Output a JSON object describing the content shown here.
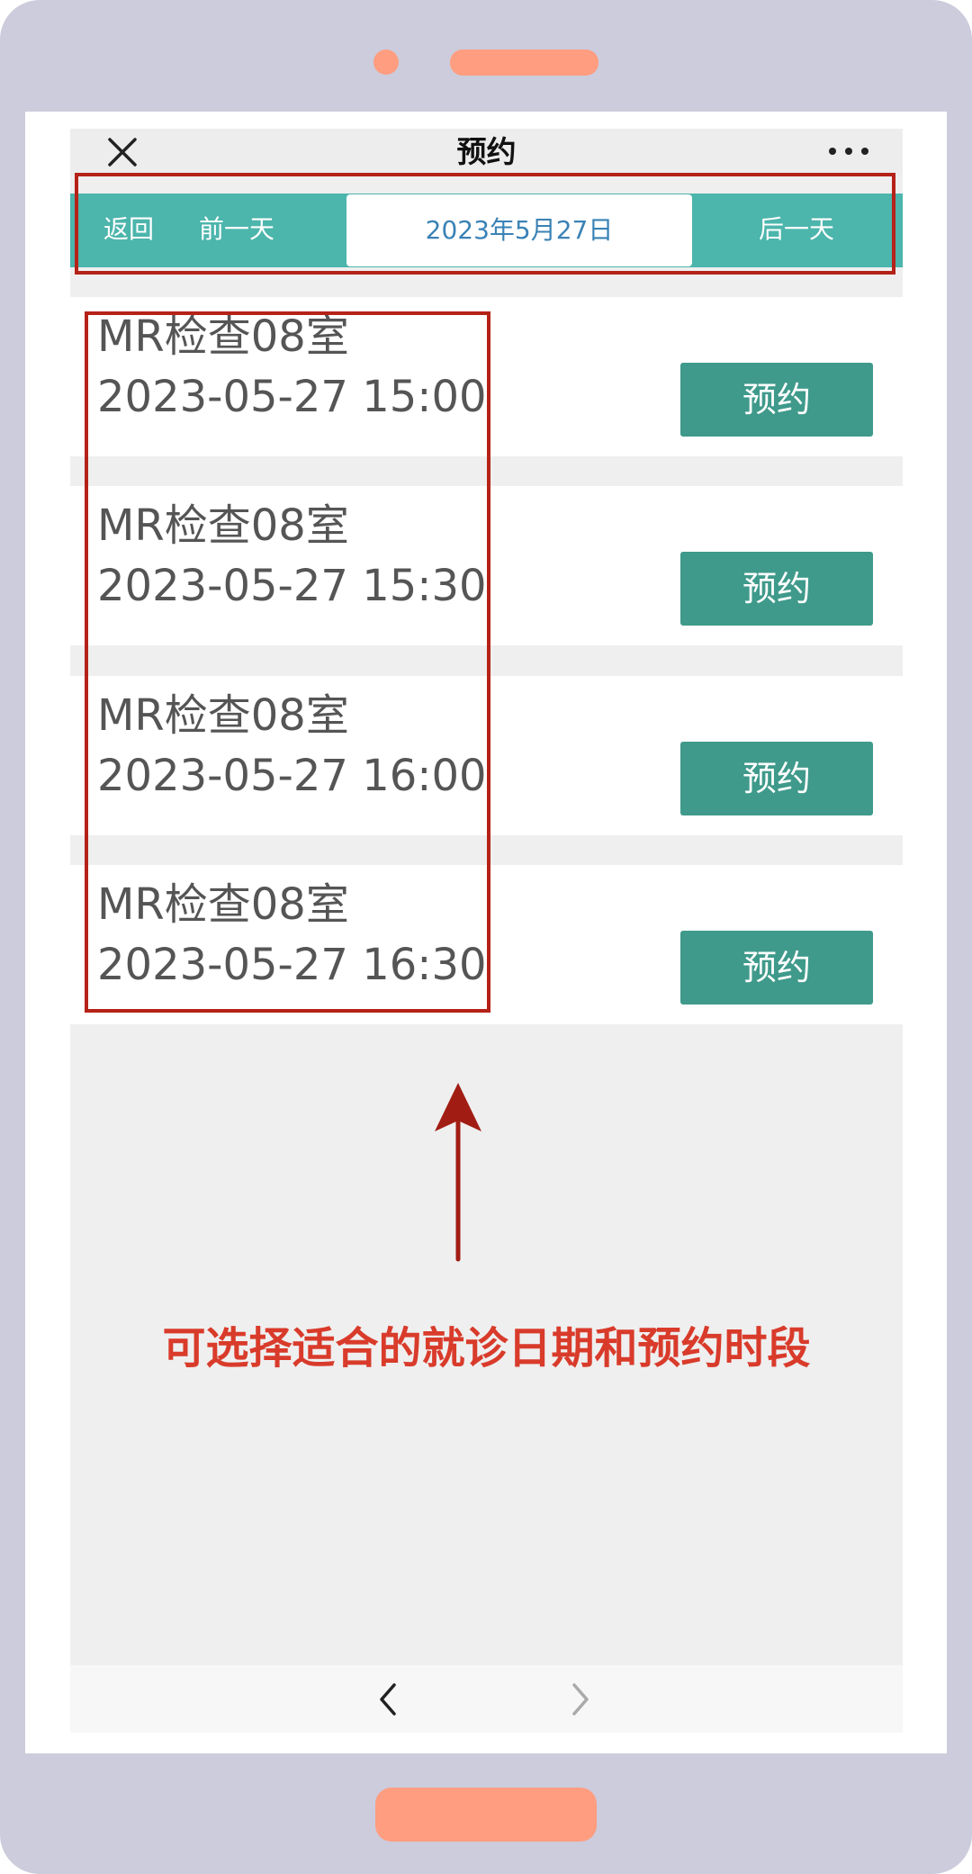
{
  "header": {
    "title": "预约",
    "close_icon": "close-icon",
    "more_icon": "more-icon"
  },
  "datebar": {
    "back_label": "返回",
    "prev_label": "前一天",
    "date": "2023年5月27日",
    "next_label": "后一天"
  },
  "slots": [
    {
      "room": "MR检查08室",
      "time": "2023-05-27 15:00",
      "button": "预约"
    },
    {
      "room": "MR检查08室",
      "time": "2023-05-27 15:30",
      "button": "预约"
    },
    {
      "room": "MR检查08室",
      "time": "2023-05-27 16:00",
      "button": "预约"
    },
    {
      "room": "MR检查08室",
      "time": "2023-05-27 16:30",
      "button": "预约"
    }
  ],
  "annotation": {
    "text": "可选择适合的就诊日期和预约时段",
    "arrow_icon": "up-arrow-icon"
  },
  "bottom_nav": {
    "back_icon": "chevron-left-icon",
    "forward_icon": "chevron-right-icon"
  },
  "colors": {
    "teal": "#4cb5ac",
    "button": "#3f9a8b",
    "highlight_red": "#b52218",
    "annotation_red": "#d93b2b",
    "device": "#ccccdd",
    "device_accent": "#ff9d80"
  }
}
